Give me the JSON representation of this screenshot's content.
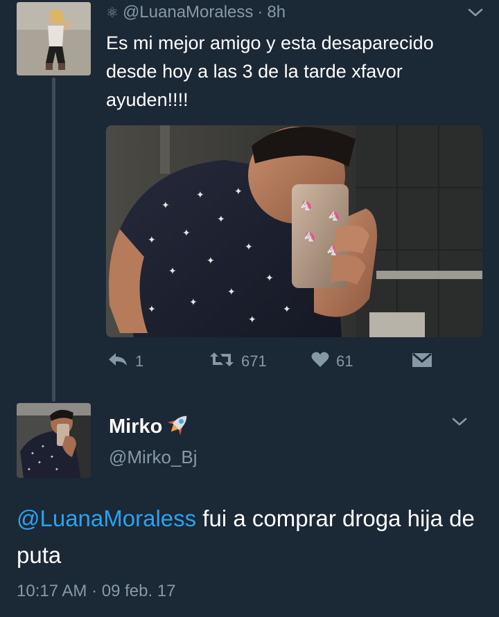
{
  "tweet": {
    "author_handle": "@LuanaMoraless",
    "separator": "·",
    "age": "8h",
    "text": "Es mi mejor amigo y esta desaparecido desde hoy a las 3 de la tarde xfavor ayuden!!!!",
    "actions": {
      "reply_count": "1",
      "retweet_count": "671",
      "like_count": "61"
    },
    "icons": {
      "header_glyph": "atom-icon",
      "menu": "chevron-down-icon",
      "reply": "reply-icon",
      "retweet": "retweet-icon",
      "like": "heart-icon",
      "dm": "envelope-icon"
    }
  },
  "reply": {
    "display_name": "Mirko",
    "name_emoji": "rocket-emoji",
    "handle": "@Mirko_Bj",
    "mention": "@LuanaMoraless",
    "text": " fui a comprar droga hija de puta",
    "timestamp": "10:17 AM · 09 feb. 17"
  },
  "colors": {
    "background": "#1b2836",
    "secondary_text": "#8899a6",
    "link": "#2aa3ef",
    "primary_text": "#ffffff"
  }
}
